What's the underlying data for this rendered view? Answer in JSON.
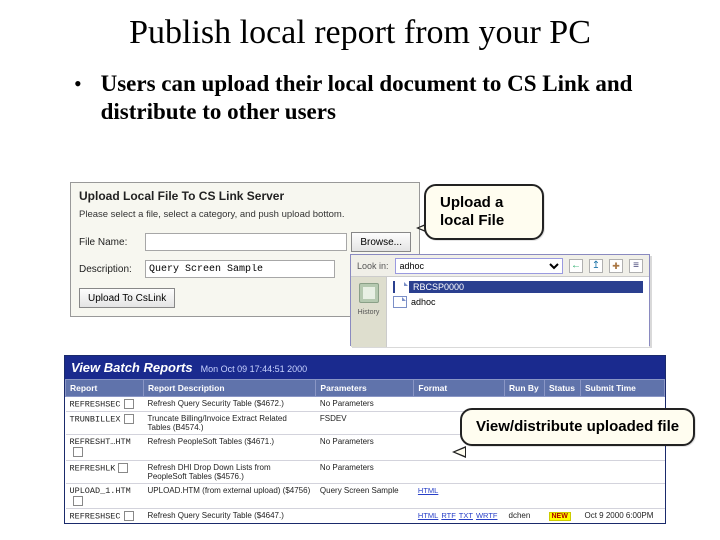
{
  "title": "Publish local report from your PC",
  "bullet": "Users can upload their local document to CS Link and distribute to other users",
  "upload": {
    "heading": "Upload Local File To CS Link Server",
    "instruction": "Please select a file, select a category, and push upload bottom.",
    "file_label": "File Name:",
    "file_value": "",
    "browse_label": "Browse...",
    "desc_label": "Description:",
    "desc_value": "Query Screen Sample",
    "submit_label": "Upload To CsLink"
  },
  "chooser": {
    "lookin_label": "Look in:",
    "folder": "adhoc",
    "side_label": "History",
    "files": [
      "RBCSP0000",
      "adhoc"
    ],
    "selected_index": 0
  },
  "callouts": {
    "upload": "Upload a local File",
    "view": "View/distribute uploaded file"
  },
  "batch": {
    "title": "View Batch Reports",
    "timestamp": "Mon Oct 09 17:44:51 2000",
    "headers": [
      "Report",
      "Report Description",
      "Parameters",
      "Format",
      "Run By",
      "Status",
      "Submit Time"
    ],
    "rows": [
      {
        "report": "REFRESHSEC",
        "desc": "Refresh Query Security Table ($4672.)",
        "params": "No Parameters",
        "format": "",
        "runby": "",
        "status": "",
        "time": ""
      },
      {
        "report": "TRUNBILLEX",
        "desc": "Truncate Billing/Invoice Extract Related Tables (B4574.)",
        "params": "FSDEV",
        "format": "",
        "runby": "",
        "status": "",
        "time": ""
      },
      {
        "report": "REFRESHT…HTM",
        "desc": "Refresh PeopleSoft Tables ($4671.)",
        "params": "No Parameters",
        "format": "",
        "runby": "",
        "status": "",
        "time": ""
      },
      {
        "report": "REFRESHLK",
        "desc": "Refresh DHI Drop Down Lists from PeopleSoft Tables ($4576.)",
        "params": "No Parameters",
        "format": "",
        "runby": "",
        "status": "",
        "time": ""
      },
      {
        "report": "UPLOAD_1.HTM",
        "desc": "UPLOAD.HTM (from external upload) ($4756)",
        "params": "Query Screen Sample",
        "format_links": [
          "HTML"
        ],
        "runby": "",
        "status": "",
        "time": ""
      },
      {
        "report": "REFRESHSEC",
        "desc": "Refresh Query Security Table ($4647.)",
        "params": "",
        "format_links": [
          "HTML",
          "RTF",
          "TXT",
          "WRTF"
        ],
        "runby": "dchen",
        "status_new": true,
        "time": "Oct 9 2000 6:00PM"
      }
    ]
  }
}
